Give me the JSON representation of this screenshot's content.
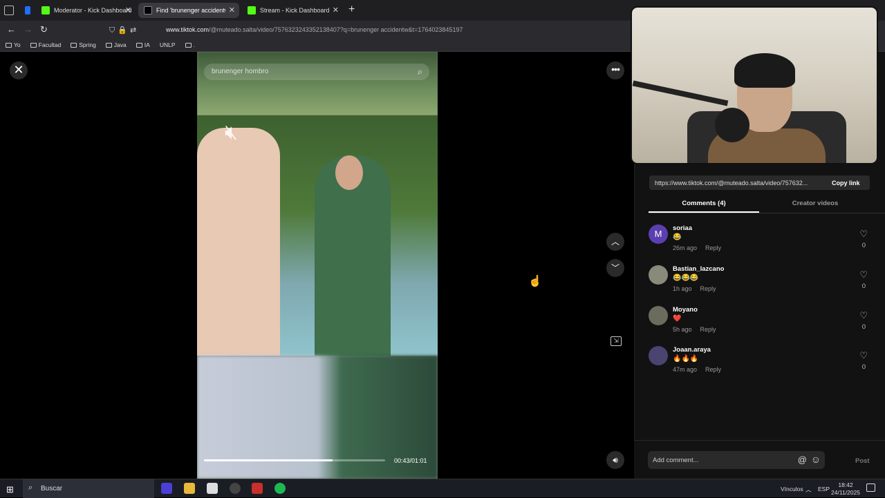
{
  "browser": {
    "tabs": [
      {
        "label": "Moderator - Kick Dashboard",
        "color": "#53fc18"
      },
      {
        "label": "Find 'brunenger accidentw'",
        "color": "#ffffff"
      },
      {
        "label": "Stream - Kick Dashboard",
        "color": "#53fc18"
      }
    ],
    "url_domain": "www.tiktok.com",
    "url_path": "/@muteado.salta/video/7576323243352138407?q=brunenger accidentw&t=1764023845197",
    "bookmarks": [
      "Yo",
      "Facultad",
      "Spring",
      "Java",
      "IA",
      "UNLP",
      "."
    ]
  },
  "player": {
    "search_placeholder": "brunenger hombro",
    "progress_fraction": 0.71,
    "timecode": "00:43/01:01"
  },
  "panel": {
    "share_link": "https://www.tiktok.com/@muteado.salta/video/757632...",
    "copy_link_label": "Copy link",
    "tab_comments": "Comments (4)",
    "tab_creator": "Creator videos",
    "comments": [
      {
        "initial": "M",
        "user": "soriaa",
        "text": "😂",
        "time": "26m ago",
        "reply": "Reply",
        "likes": "0"
      },
      {
        "initial": "",
        "user": "Bastian_lazcano",
        "text": "😂😂😂",
        "time": "1h ago",
        "reply": "Reply",
        "likes": "0"
      },
      {
        "initial": "",
        "user": "Moyano",
        "text": "❤️",
        "time": "5h ago",
        "reply": "Reply",
        "likes": "0"
      },
      {
        "initial": "",
        "user": "Joaan.araya",
        "text": "🔥🔥🔥",
        "time": "47m ago",
        "reply": "Reply",
        "likes": "0"
      }
    ],
    "comment_placeholder": "Add comment...",
    "post_label": "Post"
  },
  "taskbar": {
    "search_label": "Buscar",
    "tray_links": "Vínculos",
    "lang": "ESP",
    "time": "18:42",
    "date": "24/11/2025"
  }
}
